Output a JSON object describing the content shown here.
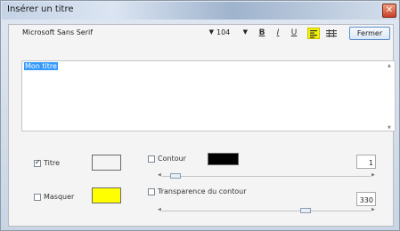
{
  "window": {
    "title": "Insérer un titre",
    "close_glyph": "✕"
  },
  "toolbar": {
    "font_name": "Microsoft Sans Serif",
    "font_size": "104",
    "bold_label": "B",
    "italic_label": "I",
    "underline_label": "U",
    "align_left_active": true,
    "fermer_label": "Fermer"
  },
  "editor": {
    "text": "Mon titre"
  },
  "options": {
    "titre": {
      "label": "Titre",
      "checked": true,
      "color": "#ffffff"
    },
    "masquer": {
      "label": "Masquer",
      "checked": false,
      "color": "#ffff00"
    },
    "contour": {
      "label": "Contour",
      "checked": false,
      "color": "#000000",
      "value": "1"
    },
    "transparence": {
      "label": "Transparence du contour",
      "checked": false,
      "value": "330"
    }
  },
  "colors": {
    "accent_yellow": "#f4f20a",
    "selection_blue": "#3399ff"
  }
}
